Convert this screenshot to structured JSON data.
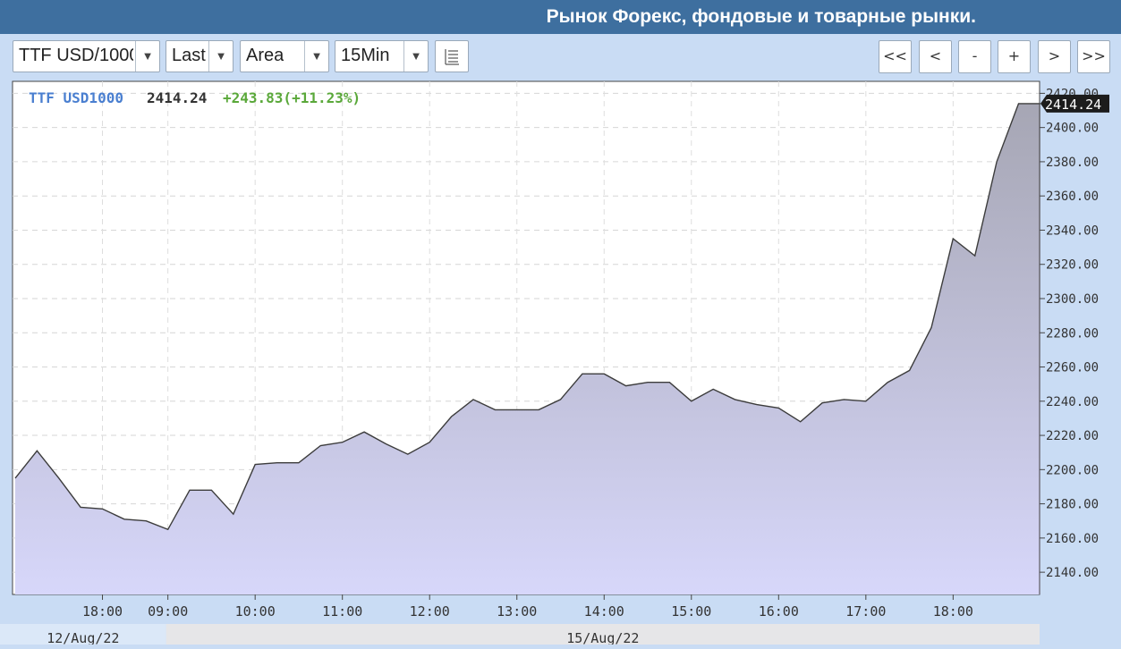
{
  "header": {
    "title": "Рынок Форекс, фондовые и товарные рынки."
  },
  "toolbar": {
    "symbol": "TTF USD/1000",
    "price_type": "Last",
    "chart_style": "Area",
    "interval": "15Min",
    "dropdown_arrow": "▼",
    "nav": {
      "first": "<<",
      "prev": "<",
      "zoom_out": "-",
      "zoom_in": "+",
      "next": ">",
      "last": ">>"
    }
  },
  "legend": {
    "symbol": "TTF USD1000",
    "last": "2414.24",
    "change": "+243.83(+11.23%)"
  },
  "colors": {
    "symbol": "#4a7fd0",
    "change": "#5aa83a",
    "fill_top": "#a6a6b4",
    "fill_bottom": "#d7d7fa",
    "line": "#3c3c3c"
  },
  "chart_data": {
    "type": "area",
    "title": "TTF USD1000",
    "ylim": [
      2127,
      2427
    ],
    "yticks": [
      2140,
      2160,
      2180,
      2200,
      2220,
      2240,
      2260,
      2280,
      2300,
      2320,
      2340,
      2360,
      2380,
      2400,
      2420
    ],
    "ytick_labels": [
      "2140.00",
      "2160.00",
      "2180.00",
      "2200.00",
      "2220.00",
      "2240.00",
      "2260.00",
      "2280.00",
      "2300.00",
      "2320.00",
      "2340.00",
      "2360.00",
      "2380.00",
      "2400.00",
      "2420.00"
    ],
    "last_value_label": "2414.24",
    "xtick_labels": [
      "18:00",
      "09:00",
      "10:00",
      "11:00",
      "12:00",
      "13:00",
      "14:00",
      "15:00",
      "16:00",
      "17:00",
      "18:00"
    ],
    "xtick_index": [
      4,
      7,
      11,
      15,
      19,
      23,
      27,
      31,
      35,
      39,
      43
    ],
    "x_count": 47,
    "date_labels": [
      {
        "label": "12/Aug/22",
        "from": 0,
        "to": 7
      },
      {
        "label": "15/Aug/22",
        "from": 7,
        "to": 47
      }
    ],
    "grid": true,
    "series": [
      {
        "values": [
          2195,
          2211,
          2195,
          2178,
          2177,
          2171,
          2170,
          2165,
          2188,
          2188,
          2174,
          2203,
          2204,
          2204,
          2214,
          2216,
          2222,
          2215,
          2209,
          2216,
          2231,
          2241,
          2235,
          2235,
          2235,
          2241,
          2256,
          2256,
          2249,
          2251,
          2251,
          2240,
          2247,
          2241,
          2238,
          2236,
          2228,
          2239,
          2241,
          2240,
          2251,
          2258,
          2283,
          2335,
          2325,
          2380,
          2414,
          2414
        ]
      }
    ]
  }
}
